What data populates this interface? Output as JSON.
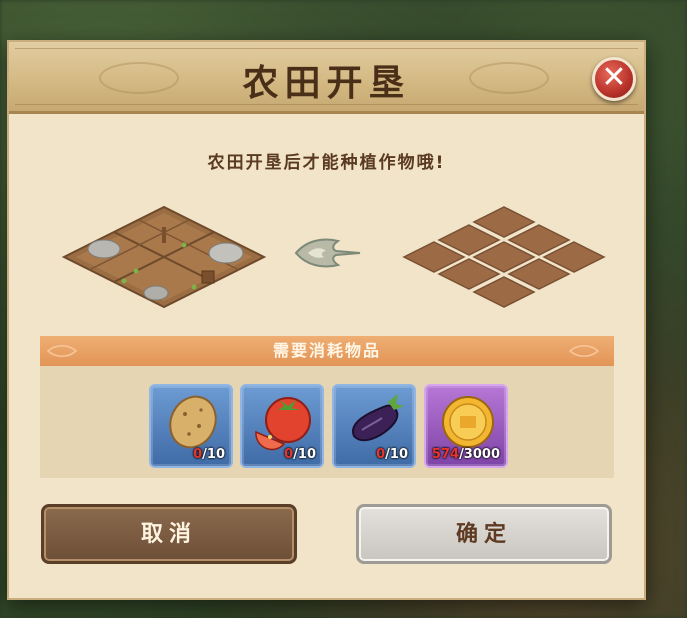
{
  "dialog": {
    "title": "农田开垦",
    "subtitle": "农田开垦后才能种植作物哦!",
    "close_icon": "close-icon"
  },
  "illustration": {
    "before": "uncultivated-farmland",
    "arrow_icon": "transform-arrow-icon",
    "after": "cultivated-farmland"
  },
  "requirements": {
    "header": "需要消耗物品",
    "items": [
      {
        "icon": "potato-icon",
        "have": "0",
        "need": "/10",
        "frame": "blue"
      },
      {
        "icon": "tomato-icon",
        "have": "0",
        "need": "/10",
        "frame": "blue"
      },
      {
        "icon": "eggplant-icon",
        "have": "0",
        "need": "/10",
        "frame": "blue"
      },
      {
        "icon": "gold-coin-icon",
        "have": "574",
        "need": "/3000",
        "frame": "purple"
      }
    ]
  },
  "buttons": {
    "cancel_label": "取消",
    "confirm_label": "确定"
  },
  "colors": {
    "dialog_bg": "#f1e4c9",
    "header_bar": "#e29556",
    "insufficient": "#e8352c",
    "cancel_button": "#6d4f37",
    "confirm_button": "#c9c5bf"
  }
}
